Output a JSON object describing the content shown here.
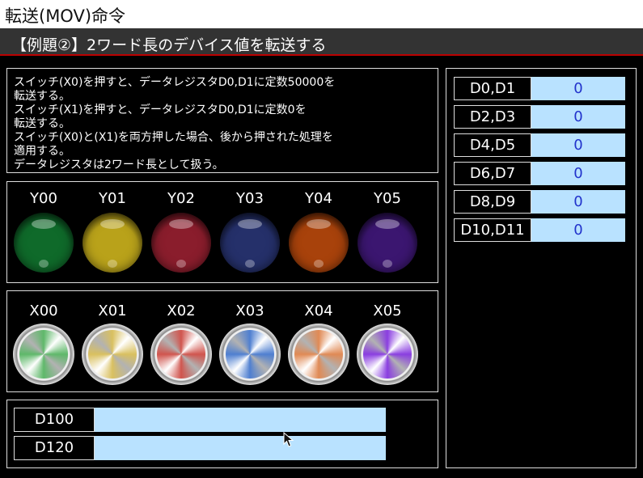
{
  "window": {
    "title": "転送(MOV)命令"
  },
  "header": {
    "title": "【例題②】2ワード長のデバイス値を転送する"
  },
  "description": {
    "lines": [
      "スイッチ(X0)を押すと、データレジスタD0,D1に定数50000を",
      "転送する。",
      "スイッチ(X1)を押すと、データレジスタD0,D1に定数0を",
      "転送する。",
      "スイッチ(X0)と(X1)を両方押した場合、後から押された処理を",
      "適用する。",
      "データレジスタは2ワード長として扱う。"
    ]
  },
  "lamps": [
    {
      "label": "Y00",
      "color": "#0f6a2a"
    },
    {
      "label": "Y01",
      "color": "#b9a21a"
    },
    {
      "label": "Y02",
      "color": "#8a1d2c"
    },
    {
      "label": "Y03",
      "color": "#25306a"
    },
    {
      "label": "Y04",
      "color": "#a8420b"
    },
    {
      "label": "Y05",
      "color": "#3b1670"
    }
  ],
  "switches": [
    {
      "label": "X00",
      "color": "#5fb86a"
    },
    {
      "label": "X01",
      "color": "#d9c060"
    },
    {
      "label": "X02",
      "color": "#d0554e"
    },
    {
      "label": "X03",
      "color": "#4f7fd0"
    },
    {
      "label": "X04",
      "color": "#e08a55"
    },
    {
      "label": "X05",
      "color": "#8a3ee0"
    }
  ],
  "data_inputs": [
    {
      "label": "D100",
      "value": ""
    },
    {
      "label": "D120",
      "value": ""
    }
  ],
  "registers": [
    {
      "label": "D0,D1",
      "value": "0"
    },
    {
      "label": "D2,D3",
      "value": "0"
    },
    {
      "label": "D4,D5",
      "value": "0"
    },
    {
      "label": "D6,D7",
      "value": "0"
    },
    {
      "label": "D8,D9",
      "value": "0"
    },
    {
      "label": "D10,D11",
      "value": "0"
    }
  ]
}
